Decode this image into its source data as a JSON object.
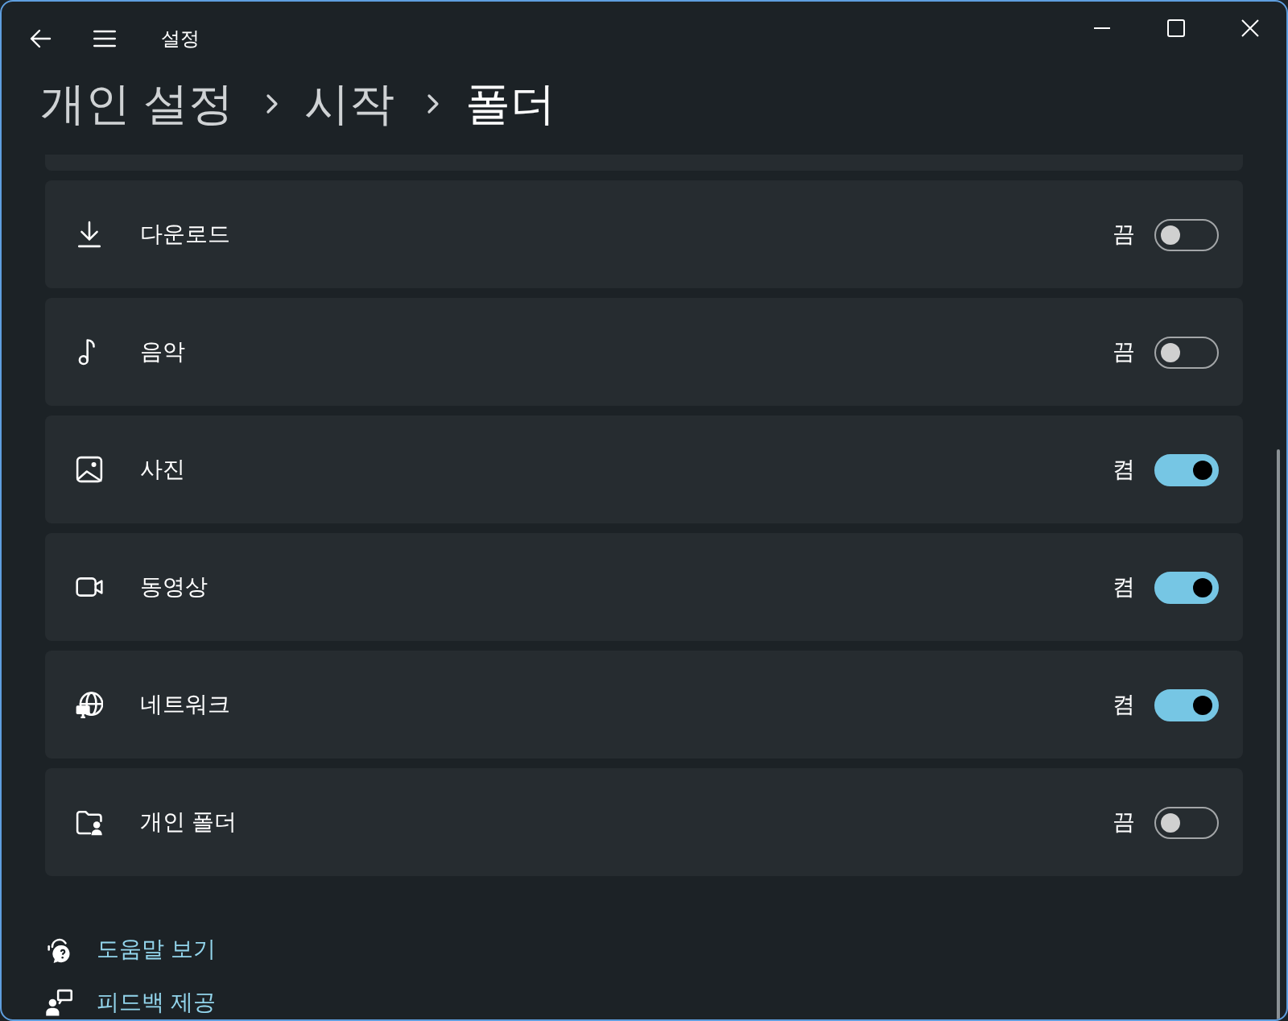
{
  "window": {
    "title": "설정"
  },
  "breadcrumb": [
    {
      "label": "개인 설정",
      "current": false
    },
    {
      "label": "시작",
      "current": false
    },
    {
      "label": "폴더",
      "current": true
    }
  ],
  "folders": [
    {
      "label": "다운로드",
      "state_label": "끔",
      "on": false
    },
    {
      "label": "음악",
      "state_label": "끔",
      "on": false
    },
    {
      "label": "사진",
      "state_label": "켬",
      "on": true
    },
    {
      "label": "동영상",
      "state_label": "켬",
      "on": true
    },
    {
      "label": "네트워크",
      "state_label": "켬",
      "on": true
    },
    {
      "label": "개인 폴더",
      "state_label": "끔",
      "on": false
    }
  ],
  "footer_links": [
    {
      "label": "도움말 보기"
    },
    {
      "label": "피드백 제공"
    }
  ]
}
